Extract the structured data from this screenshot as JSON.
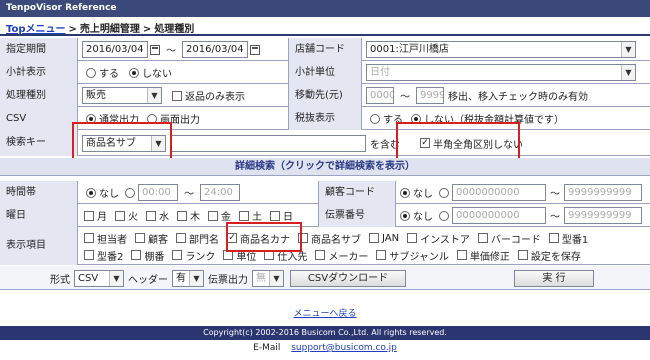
{
  "app_title": "TenpoVisor Reference",
  "breadcrumb": {
    "top": "Topメニュー",
    "sep": ">",
    "section": "売上明細管理",
    "current": "処理種別"
  },
  "form": {
    "period_label": "指定期間",
    "date_from": "2016/03/04",
    "tilde": "〜",
    "date_to": "2016/03/04",
    "store_code_label": "店舗コード",
    "store_code_value": "0001:江戸川橋店",
    "subtotal_label": "小計表示",
    "radio_yes": "する",
    "radio_no": "しない",
    "subtotal_unit_label": "小計単位",
    "subtotal_unit_value": "日付",
    "process_type_label": "処理種別",
    "process_type_value": "販売",
    "return_only_label": "返品のみ表示",
    "move_dest_label": "移動先(元)",
    "move_from": "0000",
    "move_to": "9999",
    "move_note": "移出、移入チェック時のみ有効",
    "csv_label": "CSV",
    "csv_normal": "通常出力",
    "csv_screen": "画面出力",
    "tax_label": "税抜表示",
    "tax_yes": "する",
    "tax_no": "しない（税抜金額計算値です）",
    "search_key_label": "検索キー",
    "search_key_value": "商品名サブ",
    "search_contains": "を含む",
    "fullwidth_label": "半角全角区別しない"
  },
  "detail": {
    "header": "詳細検索（クリックで詳細検索を表示）",
    "time_label": "時間帯",
    "none": "なし",
    "time_from": "00:00",
    "time_to": "24:00",
    "customer_code_label": "顧客コード",
    "cust_from": "0000000000",
    "cust_to": "9999999999",
    "weekday_label": "曜日",
    "weekdays": [
      "月",
      "火",
      "水",
      "木",
      "金",
      "土",
      "日"
    ],
    "slip_label": "伝票番号",
    "slip_from": "0000000000",
    "slip_to": "9999999999",
    "display_items_label": "表示項目",
    "items_row1": [
      "担当者",
      "顧客",
      "部門名",
      "商品名カナ",
      "商品名サブ",
      "JAN",
      "インストア",
      "バーコード",
      "型番1"
    ],
    "items_row2": [
      "型番2",
      "棚番",
      "ランク",
      "単位",
      "仕入先",
      "メーカー",
      "サブジャンル",
      "単価修正",
      "設定を保存"
    ]
  },
  "toolbar": {
    "format_label": "形式",
    "format_value": "CSV",
    "header_label": "ヘッダー",
    "header_value": "有",
    "slip_output_label": "伝票出力",
    "slip_output_value": "無",
    "csv_download": "CSVダウンロード",
    "execute": "実 行"
  },
  "footer": {
    "back_menu": "メニューへ戻る",
    "copyright": "Copyright(c) 2002-2016 Busicom Co.,Ltd. All rights reserved.",
    "email_label": "E-Mail",
    "email": "support@busicom.co.jp"
  },
  "colors": {
    "header_bar": "#3b4a7a",
    "label_bg": "#e4e7f1",
    "highlight": "#d62020",
    "link": "#2040c0"
  }
}
